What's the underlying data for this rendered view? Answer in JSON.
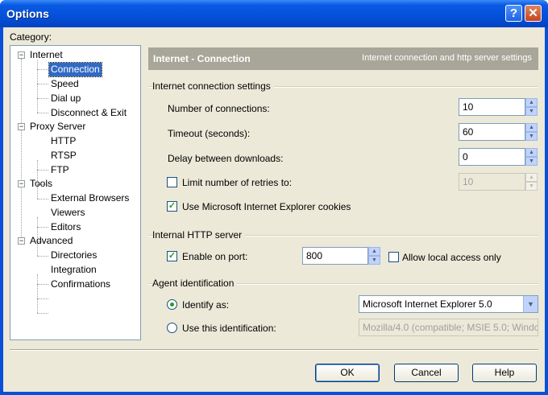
{
  "window": {
    "title": "Options",
    "help_glyph": "?",
    "close_glyph": "✕"
  },
  "category": {
    "label": "Category:",
    "tree": [
      {
        "label": "Internet",
        "expander": "−"
      },
      {
        "label": "Connection",
        "selected": true
      },
      {
        "label": "Speed"
      },
      {
        "label": "Dial up"
      },
      {
        "label": "Disconnect & Exit"
      },
      {
        "label": "Proxy Server",
        "expander": "−"
      },
      {
        "label": "HTTP"
      },
      {
        "label": "RTSP"
      },
      {
        "label": "FTP"
      },
      {
        "label": "Tools",
        "expander": "−"
      },
      {
        "label": "External Browsers"
      },
      {
        "label": "Viewers"
      },
      {
        "label": "Editors"
      },
      {
        "label": "Advanced",
        "expander": "−"
      },
      {
        "label": "Directories"
      },
      {
        "label": "Integration"
      },
      {
        "label": "Confirmations"
      }
    ]
  },
  "header": {
    "title": "Internet - Connection",
    "subtitle": "Internet connection and http server settings"
  },
  "connection_settings": {
    "group_title": "Internet connection settings",
    "num_connections_label": "Number of connections:",
    "num_connections_value": "10",
    "timeout_label": "Timeout (seconds):",
    "timeout_value": "60",
    "delay_label": "Delay between downloads:",
    "delay_value": "0",
    "limit_retries_label": "Limit number of retries to:",
    "limit_retries_checked": false,
    "limit_retries_value": "10",
    "ie_cookies_label": "Use Microsoft Internet Explorer cookies",
    "ie_cookies_checked": true
  },
  "http_server": {
    "group_title": "Internal HTTP server",
    "enable_label": "Enable on port:",
    "enable_checked": true,
    "port_value": "800",
    "allow_local_label": "Allow local access only",
    "allow_local_checked": false
  },
  "agent": {
    "group_title": "Agent identification",
    "identify_as_label": "Identify as:",
    "identify_as_selected": true,
    "identify_as_value": "Microsoft Internet Explorer 5.0",
    "use_this_label": "Use this identification:",
    "use_this_value": "Mozilla/4.0 (compatible; MSIE 5.0; Windc"
  },
  "buttons": {
    "ok": "OK",
    "cancel": "Cancel",
    "help": "Help"
  },
  "glyphs": {
    "up": "▲",
    "down": "▼",
    "check": "✓"
  }
}
